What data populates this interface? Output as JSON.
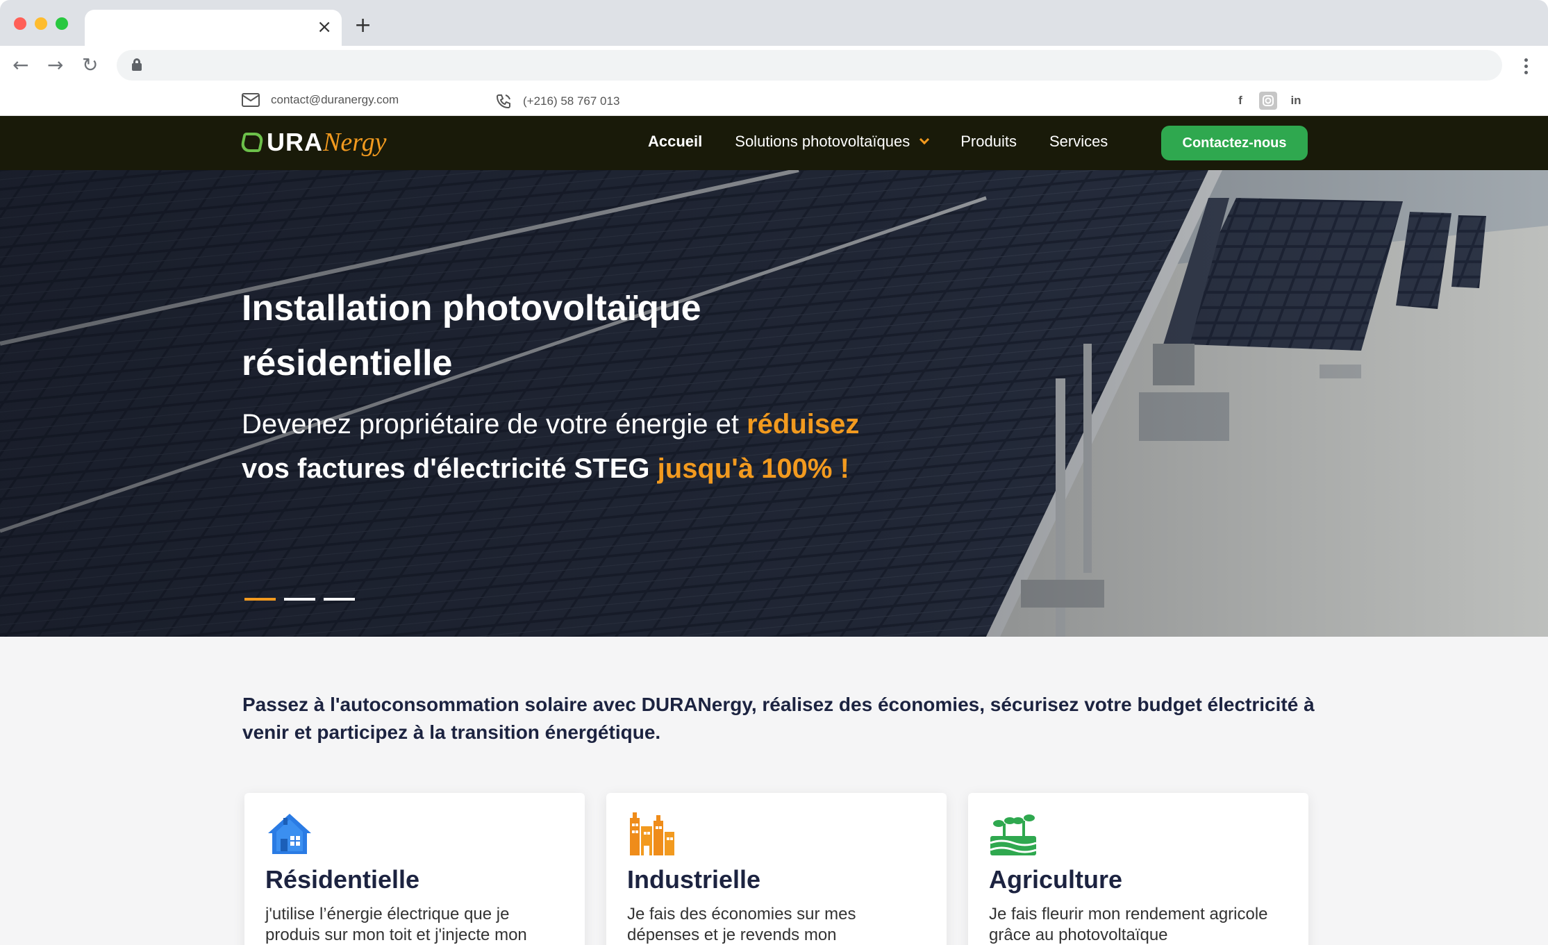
{
  "browser": {
    "tab_close": "×",
    "new_tab": "+",
    "back": "←",
    "forward": "→",
    "reload": "↻",
    "url": ""
  },
  "topbar": {
    "email": "contact@duranergy.com",
    "phone": "(+216) 58 767 013",
    "social": {
      "facebook": "f",
      "linkedin": "in"
    }
  },
  "nav": {
    "logo": {
      "part1": "URA",
      "part2": "Nergy"
    },
    "items": [
      {
        "label": "Accueil"
      },
      {
        "label": "Solutions photovoltaïques"
      },
      {
        "label": "Produits"
      },
      {
        "label": "Services"
      }
    ],
    "cta": "Contactez-nous"
  },
  "hero": {
    "title_line1": "Installation photovoltaïque",
    "title_line2": "résidentielle",
    "sub_part1": "Devenez propriétaire de votre énergie et ",
    "sub_highlight1": "réduisez",
    "sub_part2": "vos factures d'électricité STEG ",
    "sub_highlight2": "jusqu'à 100% !",
    "slides": 3,
    "active_slide": 1
  },
  "intro": "Passez à l'autoconsommation solaire avec DURANergy, réalisez des économies, sécurisez votre budget électricité à venir et participez à la transition énergétique.",
  "cards": [
    {
      "icon": "house-icon",
      "title": "Résidentielle",
      "text": "j'utilise l’énergie électrique que je produis sur mon toit et j'injecte mon"
    },
    {
      "icon": "factory-icon",
      "title": "Industrielle",
      "text": "Je fais des économies sur mes dépenses et je revends mon"
    },
    {
      "icon": "plant-icon",
      "title": "Agriculture",
      "text": "Je fais fleurir mon rendement agricole grâce au photovoltaïque"
    }
  ],
  "colors": {
    "nav_bg": "#191a09",
    "accent_orange": "#f29a1f",
    "accent_green": "#2fa84f",
    "text_dark": "#1c2340"
  }
}
